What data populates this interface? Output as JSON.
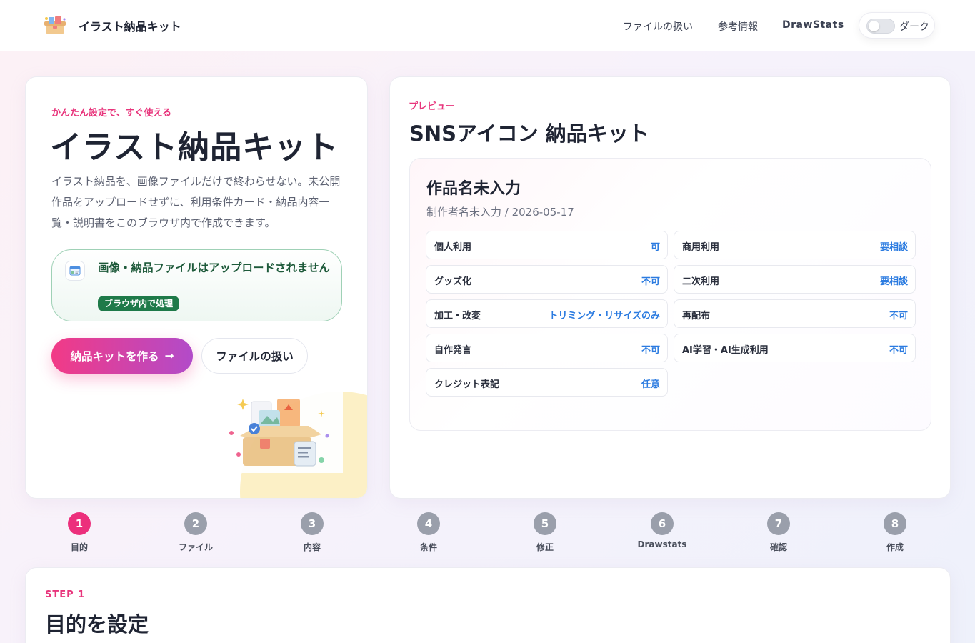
{
  "header": {
    "brand": "イラスト納品キット",
    "nav": [
      "ファイルの扱い",
      "参考情報",
      "DrawStats"
    ],
    "dark_toggle_label": "ダーク"
  },
  "hero": {
    "eyebrow": "かんたん設定で、すぐ使える",
    "title": "イラスト納品キット",
    "description": "イラスト納品を、画像ファイルだけで終わらせない。未公開作品をアップロードせずに、利用条件カード・納品内容一覧・説明書をこのブラウザ内で作成できます。",
    "notice_text": "画像・納品ファイルはアップロードされません",
    "notice_badge": "ブラウザ内で処理",
    "primary_button": "納品キットを作る",
    "secondary_button": "ファイルの扱い"
  },
  "preview": {
    "eyebrow": "プレビュー",
    "title": "SNSアイコン 納品キット",
    "work_title": "作品名未入力",
    "work_meta": "制作者名未入力 / 2026-05-17",
    "terms": [
      {
        "name": "個人利用",
        "value": "可"
      },
      {
        "name": "商用利用",
        "value": "要相談"
      },
      {
        "name": "グッズ化",
        "value": "不可"
      },
      {
        "name": "二次利用",
        "value": "要相談"
      },
      {
        "name": "加工・改変",
        "value": "トリミング・リサイズのみ"
      },
      {
        "name": "再配布",
        "value": "不可"
      },
      {
        "name": "自作発言",
        "value": "不可"
      },
      {
        "name": "AI学習・AI生成利用",
        "value": "不可"
      },
      {
        "name": "クレジット表記",
        "value": "任意"
      }
    ]
  },
  "steps": [
    {
      "num": "1",
      "label": "目的"
    },
    {
      "num": "2",
      "label": "ファイル"
    },
    {
      "num": "3",
      "label": "内容"
    },
    {
      "num": "4",
      "label": "条件"
    },
    {
      "num": "5",
      "label": "修正"
    },
    {
      "num": "6",
      "label": "Drawstats"
    },
    {
      "num": "7",
      "label": "確認"
    },
    {
      "num": "8",
      "label": "作成"
    }
  ],
  "section": {
    "eyebrow": "STEP 1",
    "title": "目的を設定"
  },
  "colors": {
    "accent": "#ec2f7c",
    "link_value": "#2b7be0",
    "safe_green": "#1e7a49"
  }
}
